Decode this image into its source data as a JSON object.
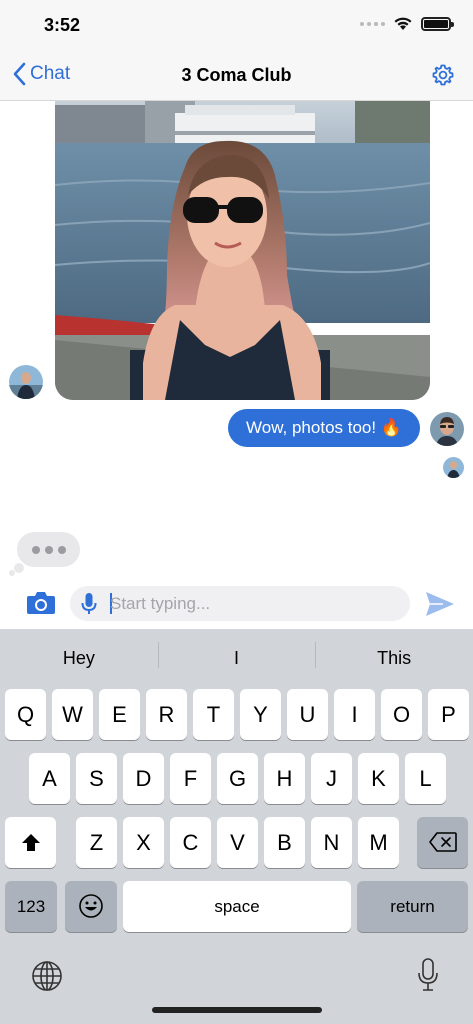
{
  "status_bar": {
    "time": "3:52"
  },
  "nav": {
    "back_label": "Chat",
    "title": "3 Coma Club"
  },
  "messages": [
    {
      "type": "photo",
      "from": "other"
    },
    {
      "type": "text",
      "from": "me",
      "text": "Wow, photos too! 🔥"
    }
  ],
  "input": {
    "placeholder": "Start typing..."
  },
  "keyboard": {
    "suggestions": [
      "Hey",
      "I",
      "This"
    ],
    "row1": [
      "Q",
      "W",
      "E",
      "R",
      "T",
      "Y",
      "U",
      "I",
      "O",
      "P"
    ],
    "row2": [
      "A",
      "S",
      "D",
      "F",
      "G",
      "H",
      "J",
      "K",
      "L"
    ],
    "row3": [
      "Z",
      "X",
      "C",
      "V",
      "B",
      "N",
      "M"
    ],
    "numbers_label": "123",
    "space_label": "space",
    "return_label": "return"
  },
  "colors": {
    "accent": "#2f6fd8",
    "keyboard_bg": "#d1d4d9",
    "bubble_gray": "#e8e8eb"
  },
  "icons": [
    "chevron-left-icon",
    "gear-icon",
    "camera-icon",
    "microphone-icon",
    "send-icon",
    "shift-icon",
    "backspace-icon",
    "emoji-icon",
    "globe-icon",
    "dictation-icon",
    "wifi-icon",
    "battery-icon"
  ]
}
